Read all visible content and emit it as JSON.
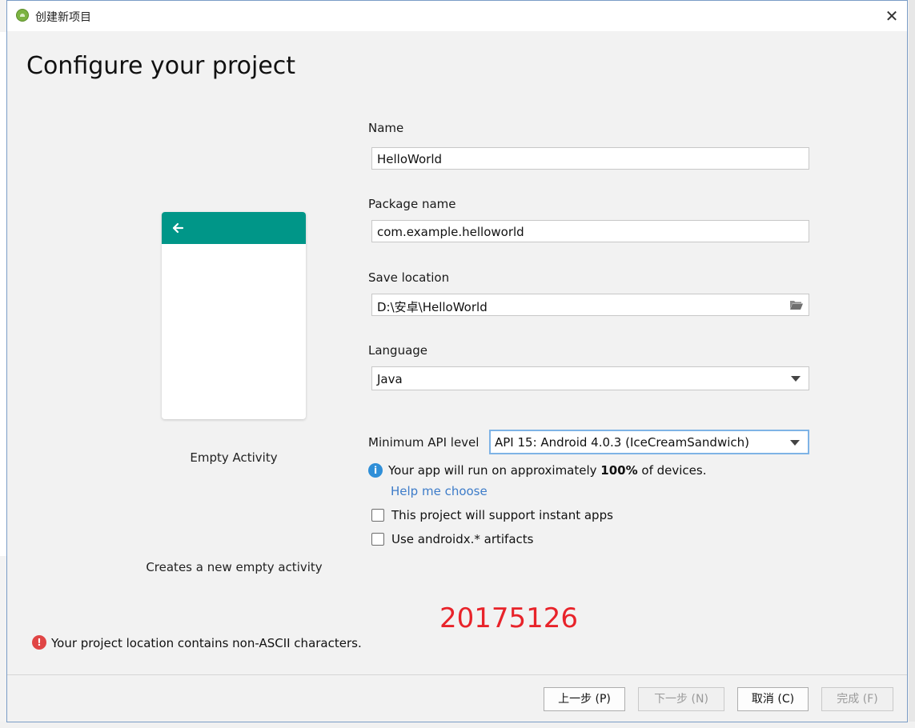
{
  "window": {
    "title": "创建新项目",
    "close_label": "✕"
  },
  "heading": "Configure your project",
  "preview": {
    "activity_name": "Empty Activity",
    "description": "Creates a new empty activity",
    "toolbar_color": "#009688"
  },
  "form": {
    "name": {
      "label": "Name",
      "value": "HelloWorld"
    },
    "package": {
      "label": "Package name",
      "value": "com.example.helloworld"
    },
    "location": {
      "label": "Save location",
      "value": "D:\\安卓\\HelloWorld"
    },
    "language": {
      "label": "Language",
      "value": "Java"
    },
    "min_api": {
      "label": "Minimum API level",
      "value": "API 15: Android 4.0.3 (IceCreamSandwich)"
    },
    "info": {
      "prefix": "Your app will run on approximately ",
      "percent": "100%",
      "suffix": " of devices."
    },
    "help_link": "Help me choose",
    "instant_apps": {
      "label": "This project will support instant apps",
      "checked": false
    },
    "androidx": {
      "label": "Use androidx.* artifacts",
      "checked": false
    }
  },
  "stamp": "20175126",
  "error_message": "Your project location contains non-ASCII characters.",
  "buttons": {
    "previous": "上一步 (P)",
    "next": "下一步 (N)",
    "cancel": "取消 (C)",
    "finish": "完成 (F)"
  },
  "colors": {
    "info": "#2f8fd8",
    "error": "#e04545",
    "link": "#3d7cc9",
    "stamp": "#e8232a"
  }
}
